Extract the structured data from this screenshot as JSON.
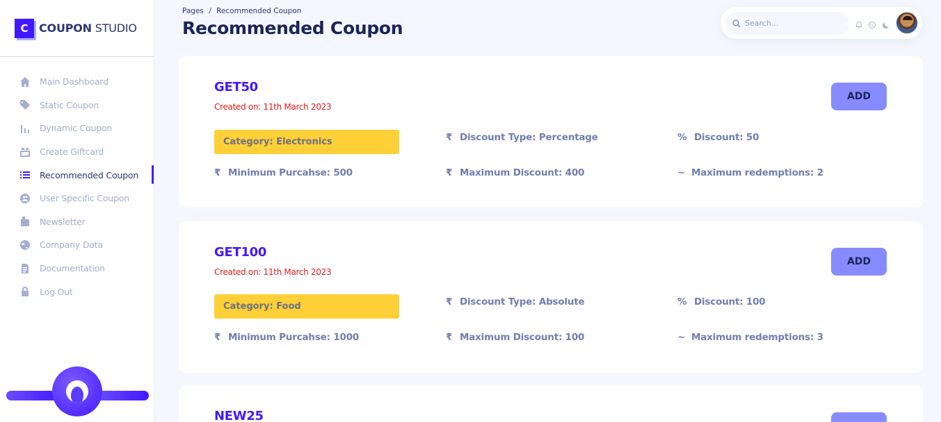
{
  "brand": {
    "mark": "C",
    "name_bold": "COUPON",
    "name_rest": " STUDIO"
  },
  "sidebar": {
    "items": [
      {
        "label": "Main Dashboard",
        "icon": "home-icon"
      },
      {
        "label": "Static Coupon",
        "icon": "tag-icon"
      },
      {
        "label": "Dynamic Coupon",
        "icon": "bar-chart-icon"
      },
      {
        "label": "Create Giftcard",
        "icon": "gift-card-icon"
      },
      {
        "label": "Recommended Coupon",
        "icon": "list-icon",
        "active": true
      },
      {
        "label": "User Specific Coupon",
        "icon": "user-globe-icon"
      },
      {
        "label": "Newsletter",
        "icon": "newsletter-icon"
      },
      {
        "label": "Company Data",
        "icon": "globe-icon"
      },
      {
        "label": "Documentation",
        "icon": "document-icon"
      },
      {
        "label": "Log Out",
        "icon": "lock-icon"
      }
    ]
  },
  "header": {
    "breadcrumb_root": "Pages",
    "breadcrumb_sep": "/",
    "breadcrumb_current": "Recommended Coupon",
    "title": "Recommended Coupon"
  },
  "topbar": {
    "search_placeholder": "Search..."
  },
  "labels": {
    "add": "ADD",
    "rupee": "₹",
    "percent": "%",
    "tilde": "~"
  },
  "coupons": [
    {
      "code": "GET50",
      "created": "Created on: 11th March 2023",
      "category": "Category: Electronics",
      "discount_type": "Discount Type: Percentage",
      "discount": "Discount: 50",
      "min_purchase": "Minimum Purcahse: 500",
      "max_discount": "Maximum Discount: 400",
      "max_redemptions": "Maximum redemptions: 2"
    },
    {
      "code": "GET100",
      "created": "Created on: 11th March 2023",
      "category": "Category: Food",
      "discount_type": "Discount Type: Absolute",
      "discount": "Discount: 100",
      "min_purchase": "Minimum Purcahse: 1000",
      "max_discount": "Maximum Discount: 100",
      "max_redemptions": "Maximum redemptions: 3"
    },
    {
      "code": "NEW25"
    }
  ],
  "colors": {
    "accent": "#4318ff",
    "button": "#868cff",
    "category": "#fcd036",
    "created": "#e31a1a"
  }
}
